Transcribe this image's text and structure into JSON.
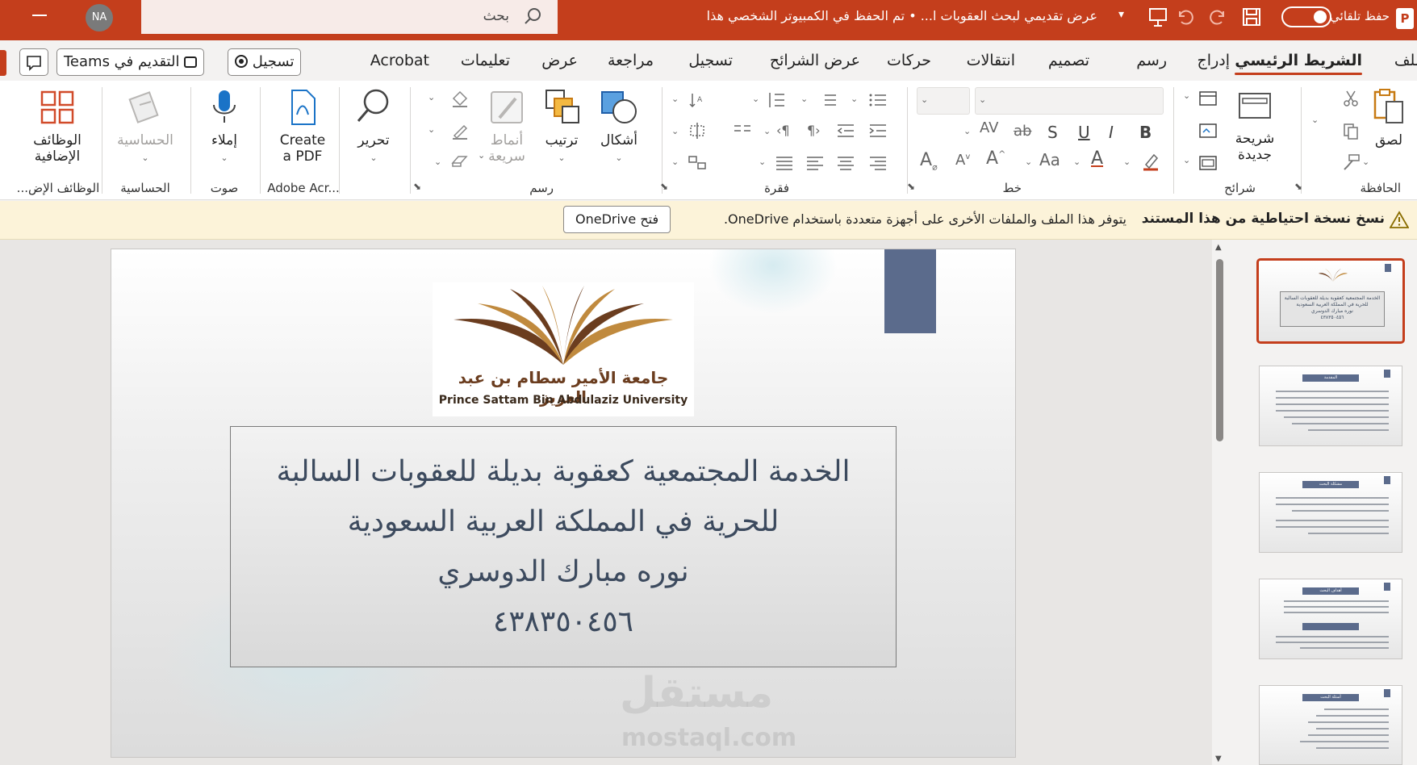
{
  "titlebar": {
    "autosave_label": "حفظ تلقائي",
    "document_title": "عرض تقديمي لبحث العقوبات ا...  •  تم الحفظ في الكمبيوتر الشخصي هذا",
    "search_placeholder": "بحث",
    "avatar_initials": "NA",
    "app_letter": "P"
  },
  "tabs": {
    "file": "ملف",
    "home": "الشريط الرئيسي",
    "insert": "إدراج",
    "draw": "رسم",
    "design": "تصميم",
    "transitions": "انتقالات",
    "animations": "حركات",
    "slideshow": "عرض الشرائح",
    "record": "تسجيل",
    "review": "مراجعة",
    "view": "عرض",
    "help": "تعليمات",
    "acrobat": "Acrobat",
    "record_button": "تسجيل",
    "present_teams": "التقديم في Teams"
  },
  "ribbon": {
    "clipboard": {
      "paste": "لصق",
      "group": "الحافظة"
    },
    "slides": {
      "new_slide_line1": "شريحة",
      "new_slide_line2": "جديدة",
      "group": "شرائح"
    },
    "font": {
      "group": "خط",
      "bold": "B",
      "italic": "I",
      "underline": "U",
      "shadow": "S",
      "strike": "ab",
      "spacing": "AV",
      "case": "Aa"
    },
    "paragraph": {
      "group": "فقرة"
    },
    "drawing": {
      "shapes": "أشكال",
      "arrange": "ترتيب",
      "quick_styles_line1": "أنماط",
      "quick_styles_line2": "سريعة",
      "group": "رسم"
    },
    "editing": {
      "edit": "تحرير"
    },
    "adobe": {
      "create_pdf_line1": "Create",
      "create_pdf_line2": "a PDF",
      "group": "Adobe Acr..."
    },
    "voice": {
      "dictate": "إملاء",
      "group": "صوت"
    },
    "sensitivity": {
      "label": "الحساسية",
      "group": "الحساسية"
    },
    "addins": {
      "label_line1": "الوظائف",
      "label_line2": "الإضافية",
      "group": "الوظائف الإض..."
    }
  },
  "notice": {
    "title": "نسخ نسخة احتياطية من هذا المستند",
    "text": "يتوفر هذا الملف والملفات الأخرى على أجهزة متعددة باستخدام OneDrive.",
    "button": "فتح OneDrive"
  },
  "slide": {
    "logo_arabic": "جامعة الأمير سطام بن عبد العزيز",
    "logo_english": "Prince Sattam Bin Abdulaziz University",
    "title_line1": "الخدمة المجتمعية كعقوبة بديلة للعقوبات السالبة",
    "title_line2": "للحرية في المملكة العربية السعودية",
    "title_line3": "نوره مبارك الدوسري",
    "title_line4": "٤٣٨٣٥٠٤٥٦",
    "watermark_ar": "مستقل",
    "watermark_en": "mostaql.com"
  },
  "thumbnails": [
    {
      "header": ""
    },
    {
      "header": "المقدمة"
    },
    {
      "header": "مشكلة البحث"
    },
    {
      "header": "أهداف البحث"
    },
    {
      "header": "أسئلة البحث"
    }
  ],
  "colors": {
    "accent": "#c43e1c",
    "slide_title": "#3c4a5e",
    "slide_block": "#5b6b8c"
  }
}
